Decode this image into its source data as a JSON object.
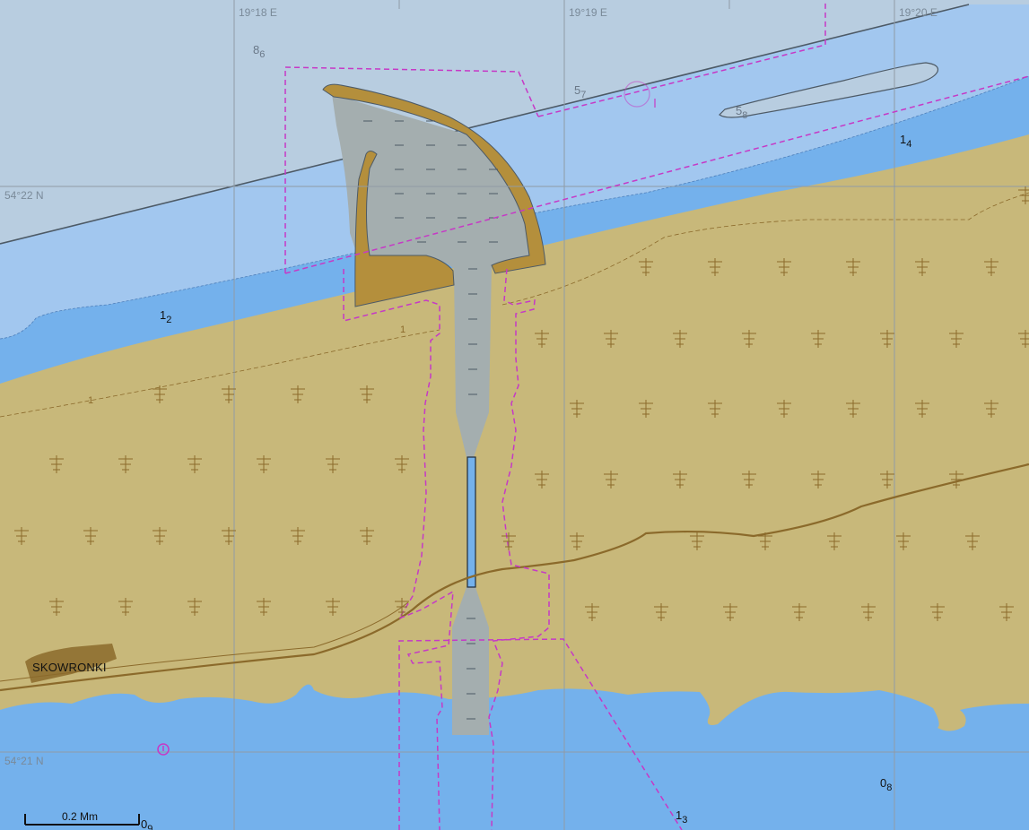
{
  "colors": {
    "deep_water": "#b8cde0",
    "mid_water": "#a2c7ef",
    "shallow_water": "#74b1ec",
    "land": "#c8b87a",
    "harbour_water": "#a4aeaf",
    "breakwater": "#b48f3c",
    "boundary": "#c639c6",
    "grid": "#8f9ba6",
    "road": "#8b6a2b"
  },
  "grid_labels": {
    "lon1": "19°18 E",
    "lon2": "19°19 E",
    "lon3": "19°20 E",
    "lat1": "54°22 N",
    "lat2": "54°21 N"
  },
  "soundings": [
    {
      "main": "8",
      "sub": "6",
      "style": "light"
    },
    {
      "main": "5",
      "sub": "7",
      "style": "light"
    },
    {
      "main": "5",
      "sub": "8",
      "style": "light"
    },
    {
      "main": "1",
      "sub": "4",
      "style": "dark"
    },
    {
      "main": "1",
      "sub": "2",
      "style": "dark"
    },
    {
      "main": "0",
      "sub": "8",
      "style": "dark"
    },
    {
      "main": "1",
      "sub": "3",
      "style": "dark"
    },
    {
      "main": "0",
      "sub": "9",
      "style": "dark"
    }
  ],
  "place_name": "SKOWRONKI",
  "land_contour_label": "1",
  "scale_bar": {
    "label": "0.2 Mm"
  },
  "icons": {
    "tree": "tree-symbol-icon",
    "anchor_light": "light-circle-icon"
  }
}
